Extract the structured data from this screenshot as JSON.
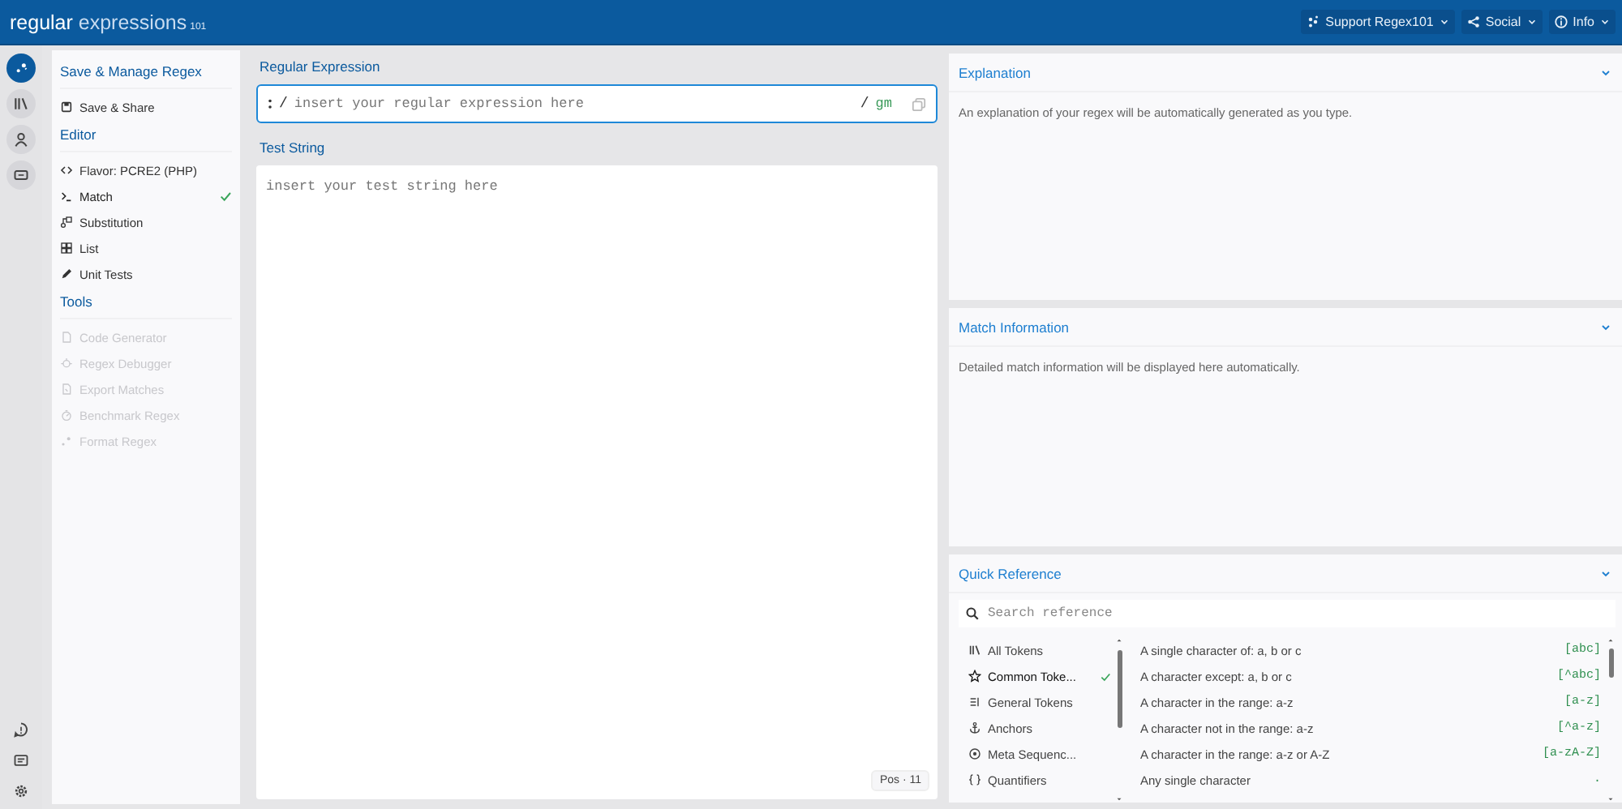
{
  "header": {
    "logo_bold": "regular",
    "logo_light": "expressions",
    "logo_sub": "101",
    "menus": [
      {
        "label": "Support Regex101"
      },
      {
        "label": "Social"
      },
      {
        "label": "Info"
      }
    ]
  },
  "rail_items": [
    {
      "selected": true
    },
    {
      "selected": false
    },
    {
      "selected": false
    },
    {
      "selected": false
    }
  ],
  "sidebar": {
    "sections": [
      {
        "title": "Save & Manage Regex",
        "items": [
          {
            "label": "Save & Share",
            "selected": false,
            "disabled": false
          }
        ]
      },
      {
        "title": "Editor",
        "items": [
          {
            "label": "Flavor: PCRE2 (PHP)",
            "selected": false,
            "disabled": false
          },
          {
            "label": "Match",
            "selected": true,
            "disabled": false
          },
          {
            "label": "Substitution",
            "selected": false,
            "disabled": false
          },
          {
            "label": "List",
            "selected": false,
            "disabled": false
          },
          {
            "label": "Unit Tests",
            "selected": false,
            "disabled": false
          }
        ]
      },
      {
        "title": "Tools",
        "items": [
          {
            "label": "Code Generator",
            "selected": false,
            "disabled": true
          },
          {
            "label": "Regex Debugger",
            "selected": false,
            "disabled": true
          },
          {
            "label": "Export Matches",
            "selected": false,
            "disabled": true
          },
          {
            "label": "Benchmark Regex",
            "selected": false,
            "disabled": true
          },
          {
            "label": "Format Regex",
            "selected": false,
            "disabled": true
          }
        ]
      }
    ]
  },
  "regex": {
    "title": "Regular Expression",
    "delimiter_left": "/",
    "placeholder": "insert your regular expression here",
    "delimiter_right": "/",
    "flags": "gm",
    "focused": true
  },
  "test_string": {
    "title": "Test String",
    "placeholder": "insert your test string here",
    "position": "Pos · 11"
  },
  "panels": [
    {
      "title": "Explanation",
      "expanded": true,
      "text": "An explanation of your regex will be automatically generated as you type."
    },
    {
      "title": "Match Information",
      "expanded": true,
      "text": "Detailed match information will be displayed here automatically."
    }
  ],
  "quick_reference": {
    "title": "Quick Reference",
    "expanded": true,
    "search_placeholder": "Search reference",
    "categories": [
      {
        "label": "All Tokens",
        "selected": false
      },
      {
        "label": "Common Toke...",
        "selected": true
      },
      {
        "label": "General Tokens",
        "selected": false
      },
      {
        "label": "Anchors",
        "selected": false
      },
      {
        "label": "Meta Sequenc...",
        "selected": false
      },
      {
        "label": "Quantifiers",
        "selected": false
      }
    ],
    "tokens": [
      {
        "description": "A single character of: a, b or c",
        "code": "[abc]"
      },
      {
        "description": "A character except: a, b or c",
        "code": "[^abc]"
      },
      {
        "description": "A character in the range: a-z",
        "code": "[a-z]"
      },
      {
        "description": "A character not in the range: a-z",
        "code": "[^a-z]"
      },
      {
        "description": "A character in the range: a-z or A-Z",
        "code": "[a-zA-Z]"
      },
      {
        "description": "Any single character",
        "code": "."
      }
    ]
  }
}
